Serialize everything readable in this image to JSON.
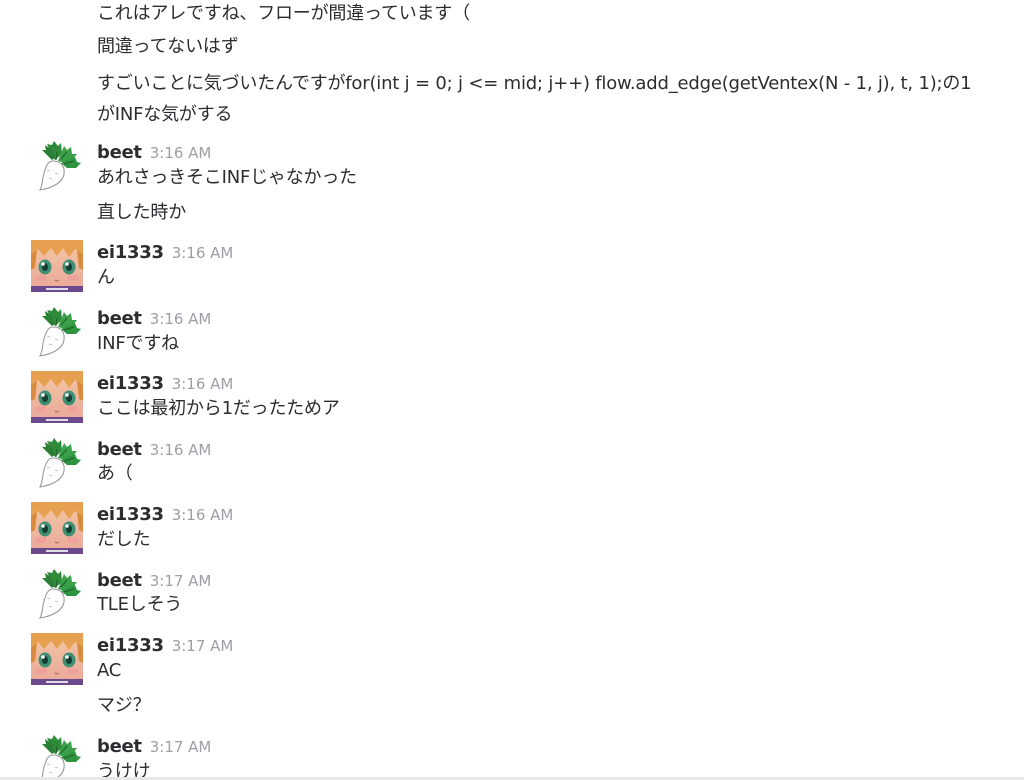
{
  "continued_lines": [
    "これはアレですね、フローが間違っています（",
    "間違ってないはず",
    "すごいことに気づいたんですがfor(int j = 0; j <= mid; j++) flow.add_edge(getVentex(N - 1, j), t, 1);の1がINFな気がする"
  ],
  "messages": [
    {
      "author": "beet",
      "avatar": "turnip-icon",
      "time": "3:16 AM",
      "lines": [
        "あれさっきそこINFじゃなかった",
        "直した時か"
      ]
    },
    {
      "author": "ei1333",
      "avatar": "anime-face-icon",
      "time": "3:16 AM",
      "lines": [
        "ん"
      ]
    },
    {
      "author": "beet",
      "avatar": "turnip-icon",
      "time": "3:16 AM",
      "lines": [
        "INFですね"
      ]
    },
    {
      "author": "ei1333",
      "avatar": "anime-face-icon",
      "time": "3:16 AM",
      "lines": [
        "ここは最初から1だったためア"
      ]
    },
    {
      "author": "beet",
      "avatar": "turnip-icon",
      "time": "3:16 AM",
      "lines": [
        "あ（"
      ]
    },
    {
      "author": "ei1333",
      "avatar": "anime-face-icon",
      "time": "3:16 AM",
      "lines": [
        "だした"
      ]
    },
    {
      "author": "beet",
      "avatar": "turnip-icon",
      "time": "3:17 AM",
      "lines": [
        "TLEしそう"
      ]
    },
    {
      "author": "ei1333",
      "avatar": "anime-face-icon",
      "time": "3:17 AM",
      "lines": [
        "AC",
        "マジ？"
      ]
    },
    {
      "author": "beet",
      "avatar": "turnip-icon",
      "time": "3:17 AM",
      "lines": [
        "うけけ"
      ]
    }
  ]
}
